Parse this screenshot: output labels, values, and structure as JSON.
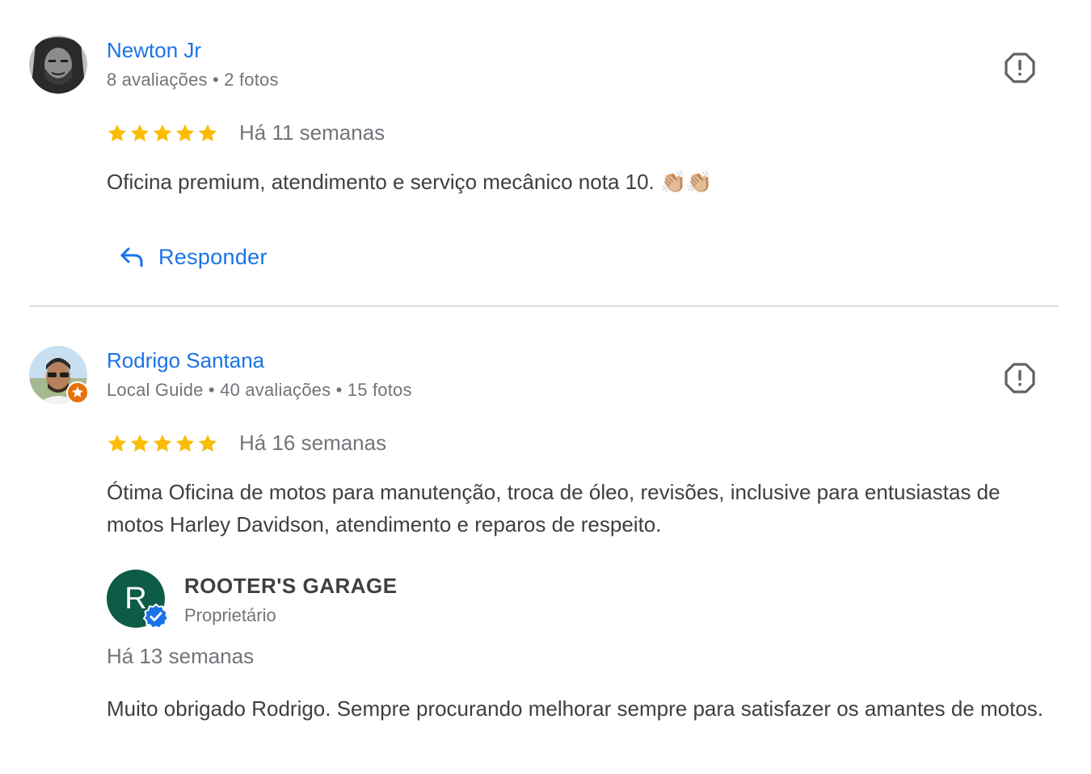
{
  "reviews": [
    {
      "author": "Newton Jr",
      "meta": "8 avaliações • 2 fotos",
      "rating": 5,
      "time": "Há 11 semanas",
      "text": "Oficina premium, atendimento e serviço mecânico nota 10. 👏🏼👏🏼",
      "reply_label": "Responder"
    },
    {
      "author": "Rodrigo Santana",
      "meta": "Local Guide • 40 avaliações • 15 fotos",
      "rating": 5,
      "time": "Há 16 semanas",
      "text": "Ótima Oficina de motos para manutenção, troca de óleo, revisões, inclusive para entusiastas de motos Harley Davidson, atendimento e reparos de respeito.",
      "owner_reply": {
        "avatar_letter": "R",
        "name": "ROOTER'S GARAGE",
        "role": "Proprietário",
        "time": "Há 13 semanas",
        "text": "Muito obrigado Rodrigo. Sempre procurando melhorar sempre para satisfazer os amantes de motos."
      }
    }
  ],
  "icons": {
    "flag": "report-flag-icon",
    "star": "star-icon",
    "reply": "reply-arrow-icon",
    "verified": "verified-check-icon",
    "local_guide": "local-guide-badge-icon"
  },
  "colors": {
    "link_blue": "#1a73e8",
    "star_yellow": "#fbbc04",
    "text_dark": "#3c4043",
    "text_gray": "#70757a",
    "owner_avatar": "#0d5c46",
    "local_guide_orange": "#e8710a"
  }
}
